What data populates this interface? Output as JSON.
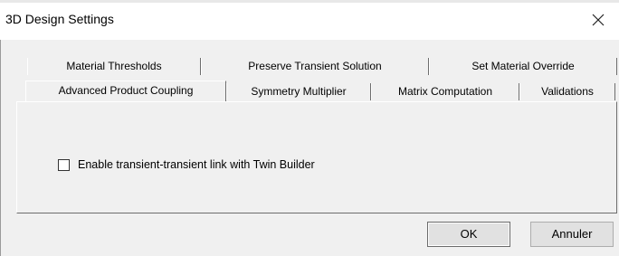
{
  "window": {
    "title": "3D Design Settings",
    "close_glyph": "✕"
  },
  "tabs": {
    "back_row": [
      {
        "label": "Material Thresholds"
      },
      {
        "label": "Preserve Transient Solution"
      },
      {
        "label": "Set Material Override"
      }
    ],
    "front_row": [
      {
        "label": "Advanced Product Coupling",
        "selected": true
      },
      {
        "label": "Symmetry Multiplier"
      },
      {
        "label": "Matrix Computation"
      },
      {
        "label": "Validations"
      }
    ]
  },
  "panel": {
    "checkbox": {
      "label": "Enable transient-transient link with Twin Builder",
      "checked": false
    }
  },
  "buttons": {
    "ok": "OK",
    "cancel": "Annuler"
  }
}
